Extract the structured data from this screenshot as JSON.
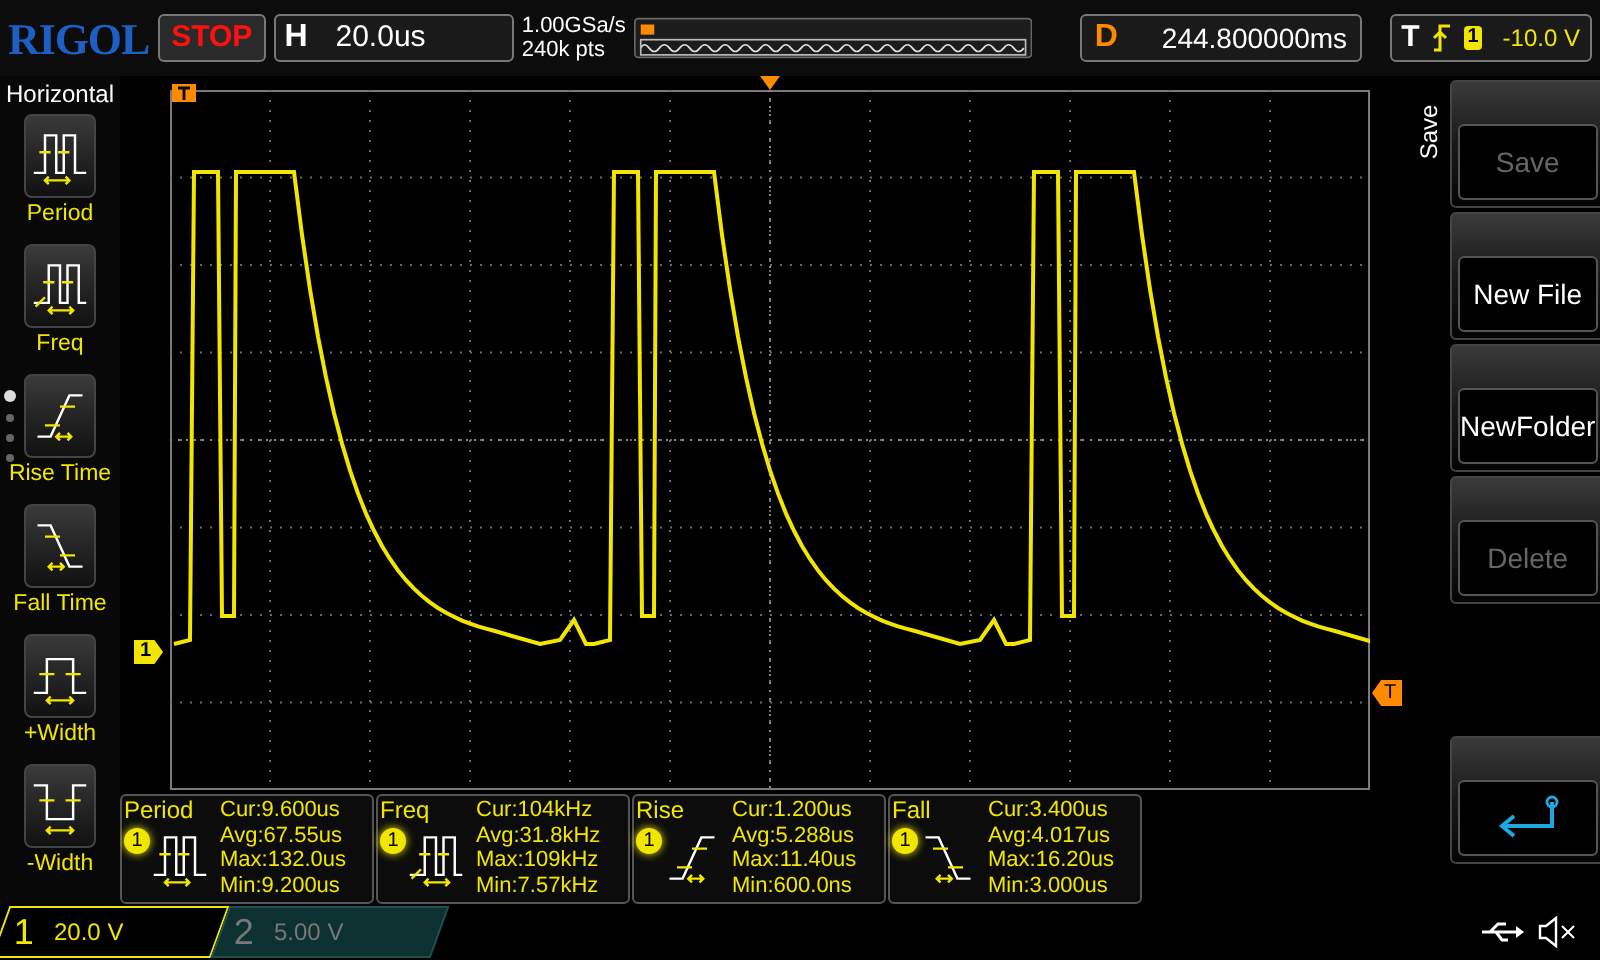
{
  "brand": "RIGOL",
  "run_state": {
    "label": "STOP"
  },
  "timebase": {
    "label": "H",
    "value": "20.0us"
  },
  "sample": {
    "rate": "1.00GSa/s",
    "depth": "240k pts"
  },
  "delay": {
    "label": "D",
    "value": "244.800000ms"
  },
  "trigger": {
    "label": "T",
    "source": "1",
    "level": "-10.0 V"
  },
  "left_menu": {
    "title": "Horizontal",
    "items": [
      {
        "label": "Period",
        "kind": "period"
      },
      {
        "label": "Freq",
        "kind": "freq"
      },
      {
        "label": "Rise Time",
        "kind": "rise"
      },
      {
        "label": "Fall Time",
        "kind": "fall"
      },
      {
        "label": "+Width",
        "kind": "pwidth"
      },
      {
        "label": "-Width",
        "kind": "nwidth"
      }
    ],
    "pages": [
      {
        "selected": true
      },
      {
        "selected": false
      },
      {
        "selected": false
      },
      {
        "selected": false
      }
    ]
  },
  "plot": {
    "channel_marker": "1",
    "trigger_marker": "T"
  },
  "measurements": [
    {
      "title": "Period",
      "kind": "period",
      "source": "1",
      "lines": [
        "Cur:9.600us",
        "Avg:67.55us",
        "Max:132.0us",
        "Min:9.200us"
      ]
    },
    {
      "title": "Freq",
      "kind": "freq",
      "source": "1",
      "lines": [
        "Cur:104kHz",
        "Avg:31.8kHz",
        "Max:109kHz",
        "Min:7.57kHz"
      ]
    },
    {
      "title": "Rise",
      "kind": "rise",
      "source": "1",
      "lines": [
        "Cur:1.200us",
        "Avg:5.288us",
        "Max:11.40us",
        "Min:600.0ns"
      ]
    },
    {
      "title": "Fall",
      "kind": "fall",
      "source": "1",
      "lines": [
        "Cur:3.400us",
        "Avg:4.017us",
        "Max:16.20us",
        "Min:3.000us"
      ]
    }
  ],
  "right_menu": {
    "title": "Save",
    "buttons": [
      {
        "kind": "text",
        "label": "Save",
        "disabled": true
      },
      {
        "kind": "text",
        "label": "New File",
        "disabled": false
      },
      {
        "kind": "text",
        "label": "NewFolder",
        "disabled": false
      },
      {
        "kind": "text",
        "label": "Delete",
        "disabled": true
      },
      {
        "kind": "back",
        "disabled": false
      }
    ]
  },
  "channels": [
    {
      "number": "1",
      "scale": "20.0 V",
      "active": true
    },
    {
      "number": "2",
      "scale": "5.00 V",
      "active": false
    }
  ]
}
